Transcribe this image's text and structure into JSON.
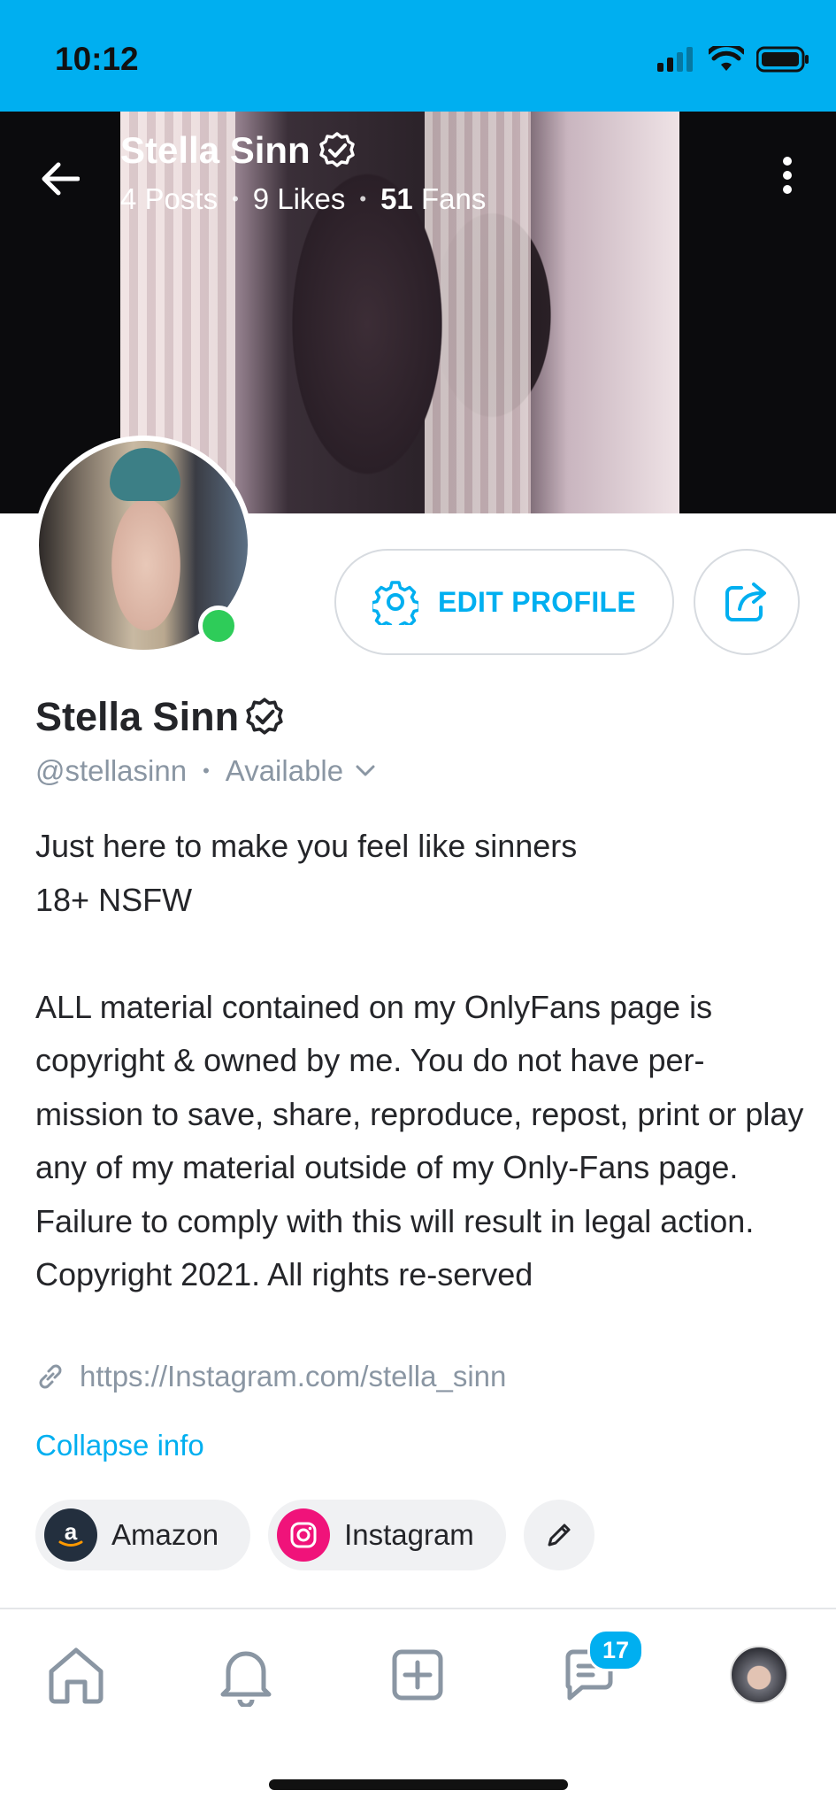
{
  "status_bar": {
    "time": "10:12"
  },
  "header": {
    "title": "Stella Sinn",
    "stats": [
      {
        "count": "4",
        "label": "Posts"
      },
      {
        "count": "9",
        "label": "Likes"
      },
      {
        "count": "51",
        "label": "Fans"
      }
    ]
  },
  "profile": {
    "name": "Stella Sinn",
    "handle": "@stellasinn",
    "status": "Available",
    "edit_label": "EDIT PROFILE",
    "bio": [
      "Just here to make you feel like sinners",
      "18+ NSFW",
      "",
      "ALL material contained on my OnlyFans page is copyright & owned by me. You do not have per-mission to save, share, reproduce, repost, print or play any of my material outside of my Only-Fans page. Failure to comply with this will result in legal action. Copyright 2021. All rights re-served"
    ],
    "link": "https://Instagram.com/stella_sinn",
    "collapse_label": "Collapse info",
    "social": [
      {
        "label": "Amazon",
        "icon": "amazon-icon"
      },
      {
        "label": "Instagram",
        "icon": "instagram-icon"
      }
    ]
  },
  "tabbar": {
    "items": [
      "home-icon",
      "bell-icon",
      "add-post-icon",
      "messages-icon",
      "profile-avatar"
    ],
    "messages_badge": "17"
  },
  "colors": {
    "accent": "#00aff0",
    "online": "#2ecc59",
    "muted": "#8a96a3"
  }
}
